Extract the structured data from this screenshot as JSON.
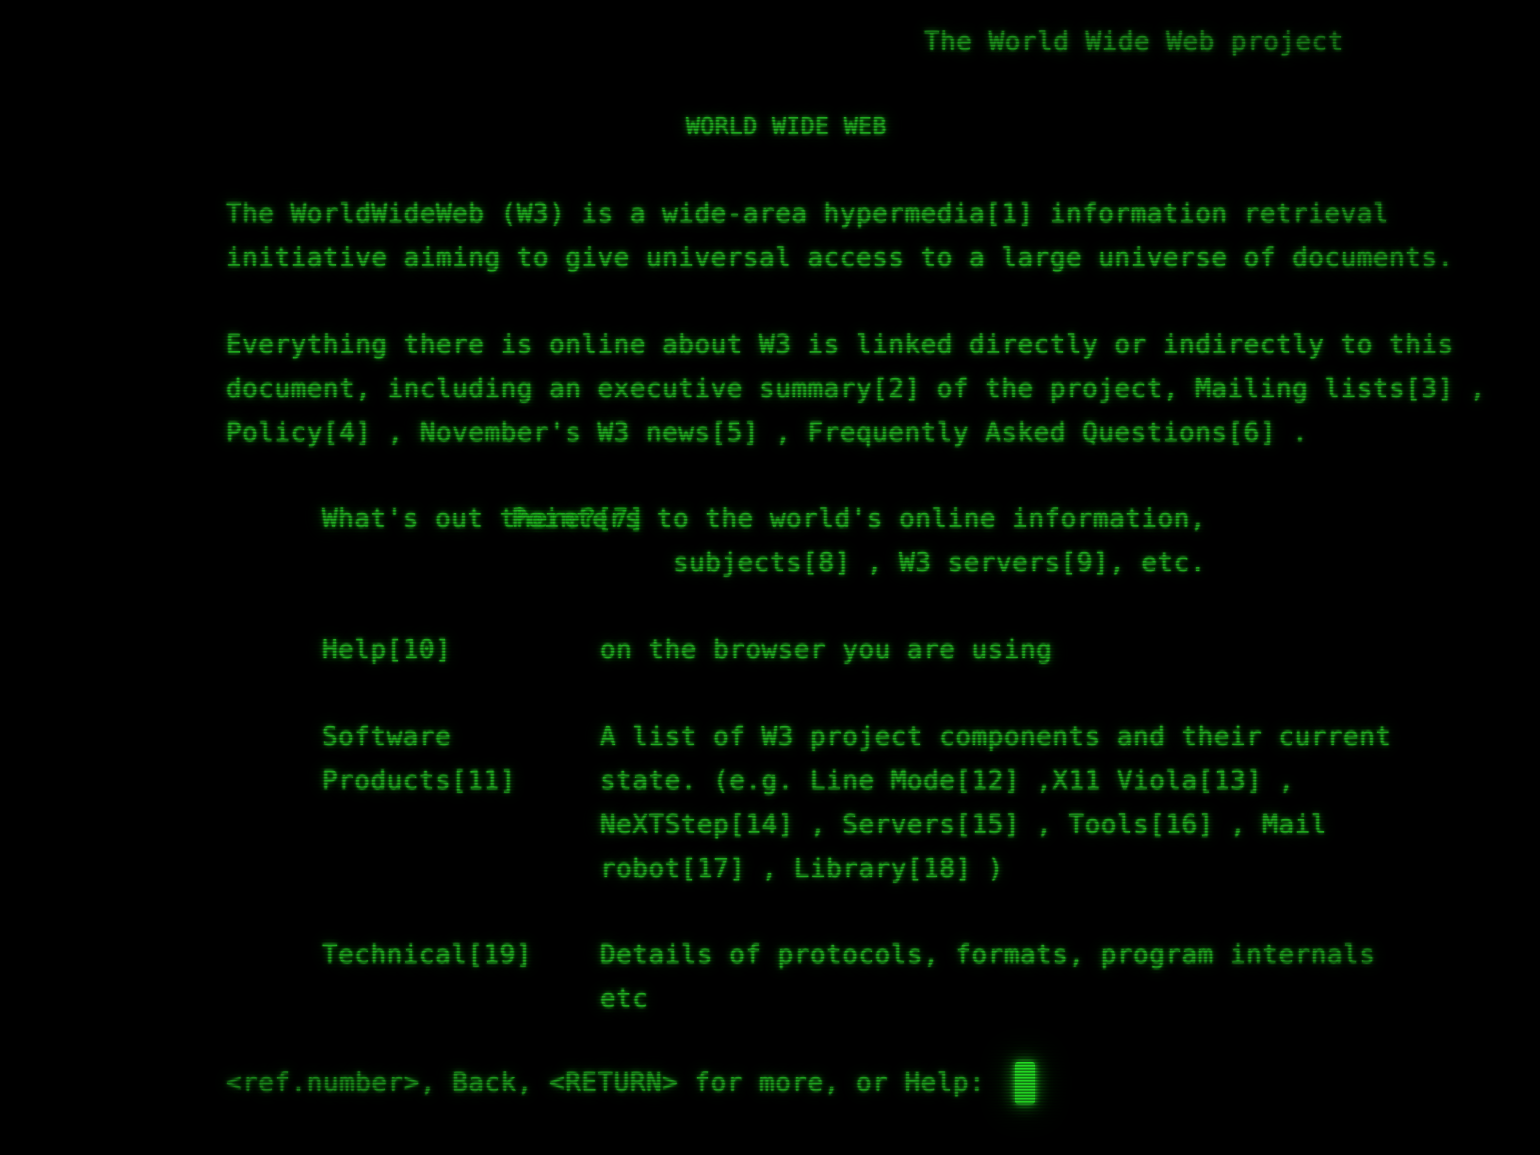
{
  "terminal": {
    "header_line": "The World Wide Web project",
    "document_title": "WORLD WIDE WEB",
    "paragraph_1": "The WorldWideWeb (W3) is a wide-area hypermedia[1] information retrieval\ninitiative aiming to give universal access to a large universe of documents.",
    "paragraph_2": "Everything there is online about W3 is linked directly or indirectly to this\ndocument, including an executive summary[2] of the project, Mailing lists[3] ,\nPolicy[4] , November's W3 news[5] , Frequently Asked Questions[6] .",
    "menu": [
      {
        "label": "What's out there?[7]",
        "description": "Pointers to the world's online information,\nsubjects[8] , W3 servers[9], etc."
      },
      {
        "label": "Help[10]",
        "description": "on the browser you are using"
      },
      {
        "label": "Software\nProducts[11]",
        "description": "A list of W3 project components and their current\nstate. (e.g. Line Mode[12] ,X11 Viola[13] ,\nNeXTStep[14] , Servers[15] , Tools[16] , Mail\nrobot[17] , Library[18] )"
      },
      {
        "label": "Technical[19]",
        "description": "Details of protocols, formats, program internals\netc"
      }
    ],
    "prompt": "<ref.number>, Back, <RETURN> for more, or Help:",
    "cursor_glyph": "block-cursor",
    "colors": {
      "background": "#000000",
      "text": "#20ab20",
      "glow": "#2ee62e",
      "cursor": "#26ee26"
    }
  }
}
